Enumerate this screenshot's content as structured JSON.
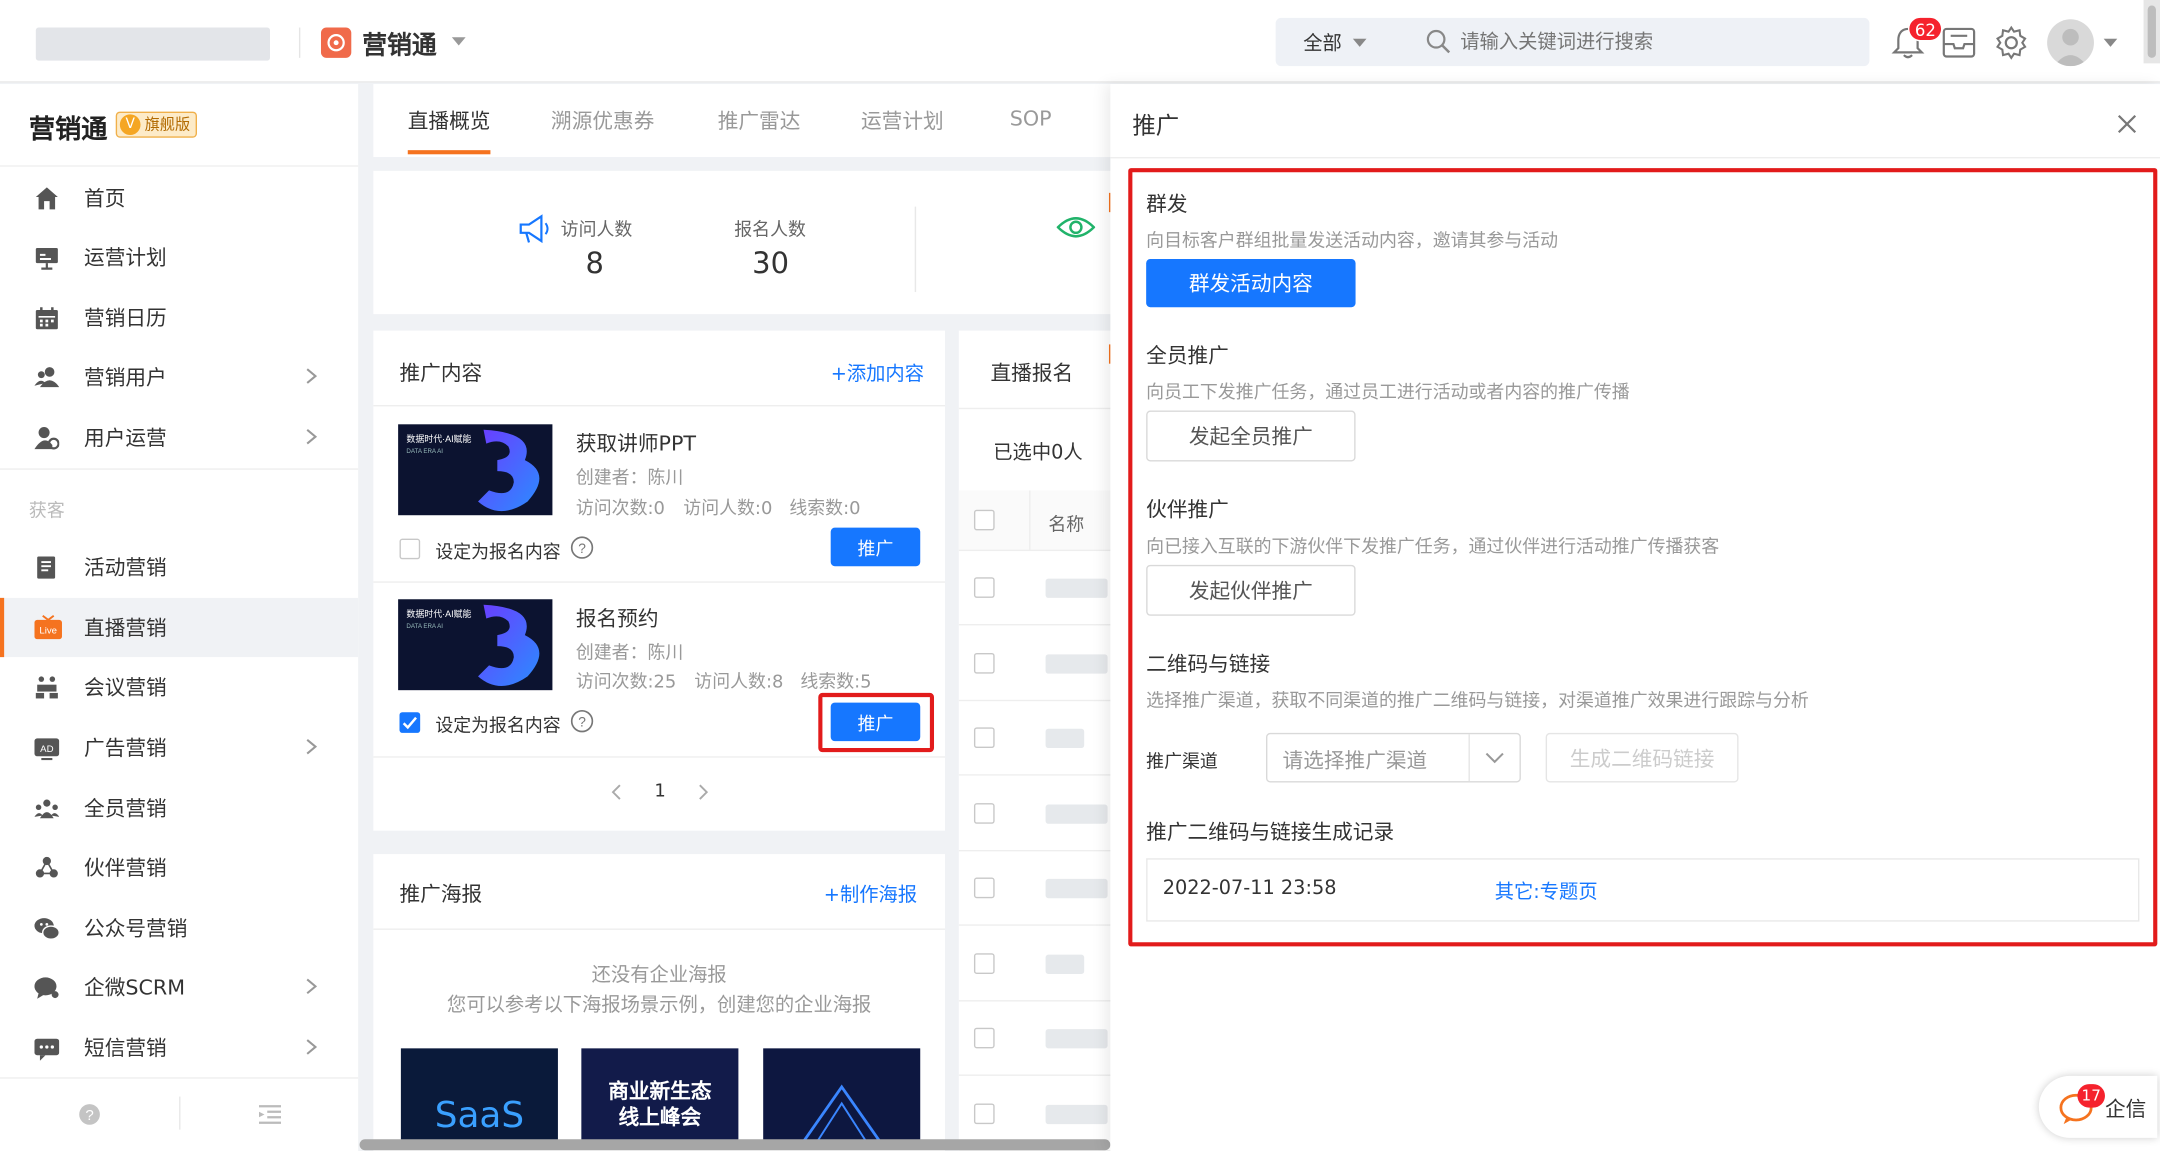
{
  "header": {
    "product_name": "营销通",
    "scope_select": "全部",
    "search_placeholder": "请输入关键词进行搜索",
    "notification_count": "62"
  },
  "sidebar": {
    "product": "营销通",
    "edition": "旗舰版",
    "items": [
      {
        "label": "首页",
        "icon": "home-icon"
      },
      {
        "label": "运营计划",
        "icon": "plan-icon"
      },
      {
        "label": "营销日历",
        "icon": "calendar-icon"
      },
      {
        "label": "营销用户",
        "icon": "users-icon"
      },
      {
        "label": "用户运营",
        "icon": "user-ops-icon"
      },
      {
        "label": "活动营销",
        "icon": "activity-icon"
      },
      {
        "label": "直播营销",
        "icon": "live-icon"
      },
      {
        "label": "会议营销",
        "icon": "meeting-icon"
      },
      {
        "label": "广告营销",
        "icon": "ad-icon"
      },
      {
        "label": "全员营销",
        "icon": "all-staff-icon"
      },
      {
        "label": "伙伴营销",
        "icon": "partner-icon"
      },
      {
        "label": "公众号营销",
        "icon": "wechat-icon"
      },
      {
        "label": "企微SCRM",
        "icon": "wecom-icon"
      },
      {
        "label": "短信营销",
        "icon": "sms-icon"
      }
    ],
    "group_label": "获客",
    "live_badge": "Live",
    "ad_badge": "AD"
  },
  "tabs": [
    "直播概览",
    "溯源优惠券",
    "推广雷达",
    "运营计划",
    "SOP"
  ],
  "stats": {
    "visitors_label": "访问人数",
    "visitors_value": "8",
    "signups_label": "报名人数",
    "signups_value": "30"
  },
  "promo_content": {
    "title": "推广内容",
    "add_link": "+添加内容",
    "items": [
      {
        "title": "获取讲师PPT",
        "creator": "创建者：陈川",
        "visits": "访问次数:0",
        "visitors": "访问人数:0",
        "leads": "线索数:0",
        "checkbox_label": "设定为报名内容",
        "checked": false,
        "button": "推广"
      },
      {
        "title": "报名预约",
        "creator": "创建者：陈川",
        "visits": "访问次数:25",
        "visitors": "访问人数:8",
        "leads": "线索数:5",
        "checkbox_label": "设定为报名内容",
        "checked": true,
        "button": "推广"
      }
    ],
    "page": "1",
    "thumb_caption": "数据时代·AI赋能",
    "thumb_sub": "DATA ERA AI"
  },
  "posters": {
    "title": "推广海报",
    "add_link": "+制作海报",
    "empty_line1": "还没有企业海报",
    "empty_line2": "您可以参考以下海报场景示例，创建您的企业海报",
    "samples": [
      "SaaS",
      "商业新生态 线上峰会",
      ""
    ]
  },
  "registrations": {
    "title": "直播报名",
    "selected": "已选中0人",
    "col_name": "名称"
  },
  "drawer": {
    "title": "推广",
    "sections": [
      {
        "title": "群发",
        "desc": "向目标客户群组批量发送活动内容，邀请其参与活动",
        "button": "群发活动内容"
      },
      {
        "title": "全员推广",
        "desc": "向员工下发推广任务，通过员工进行活动或者内容的推广传播",
        "button": "发起全员推广"
      },
      {
        "title": "伙伴推广",
        "desc": "向已接入互联的下游伙伴下发推广任务，通过伙伴进行活动推广传播获客",
        "button": "发起伙伴推广"
      },
      {
        "title": "二维码与链接",
        "desc": "选择推广渠道，获取不同渠道的推广二维码与链接，对渠道推广效果进行跟踪与分析"
      }
    ],
    "channel_label": "推广渠道",
    "channel_placeholder": "请选择推广渠道",
    "generate_button": "生成二维码链接",
    "record_title": "推广二维码与链接生成记录",
    "record_time": "2022-07-11 23:58",
    "record_link": "其它:专题页"
  },
  "chat": {
    "badge": "17",
    "label": "企信"
  },
  "colors": {
    "accent": "#1677ff",
    "highlight": "#e21b1b",
    "active": "#f5731f"
  }
}
